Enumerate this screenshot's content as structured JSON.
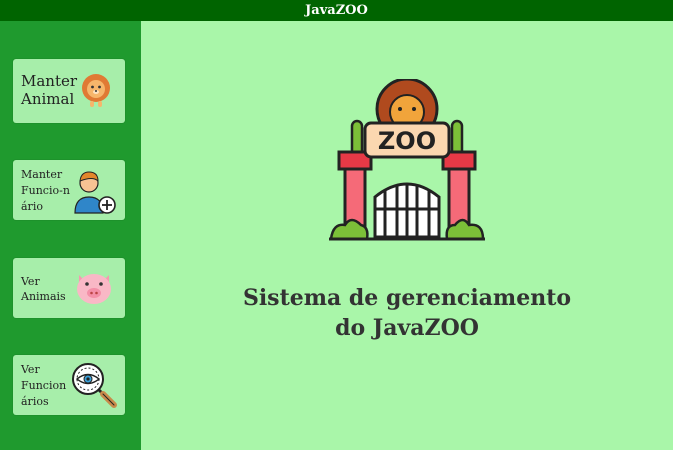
{
  "window": {
    "title": "JavaZOO"
  },
  "sidebar": {
    "items": [
      {
        "label": "Manter\nAnimal",
        "icon": "lion-icon"
      },
      {
        "label": "Manter\nFuncio-n\nário",
        "icon": "add-user-icon"
      },
      {
        "label": "Ver\nAnimais",
        "icon": "pig-icon"
      },
      {
        "label": "Ver\nFuncion\nários",
        "icon": "magnifier-eye-icon"
      }
    ]
  },
  "main": {
    "logo": {
      "sign_text": "ZOO",
      "icon": "zoo-gate-icon"
    },
    "headline": "Sistema de gerenciamento\ndo JavaZOO"
  },
  "colors": {
    "titlebar": "#006400",
    "sidebar": "#1f9a2e",
    "button": "#a7eeaa",
    "main": "#a9f6a9"
  }
}
